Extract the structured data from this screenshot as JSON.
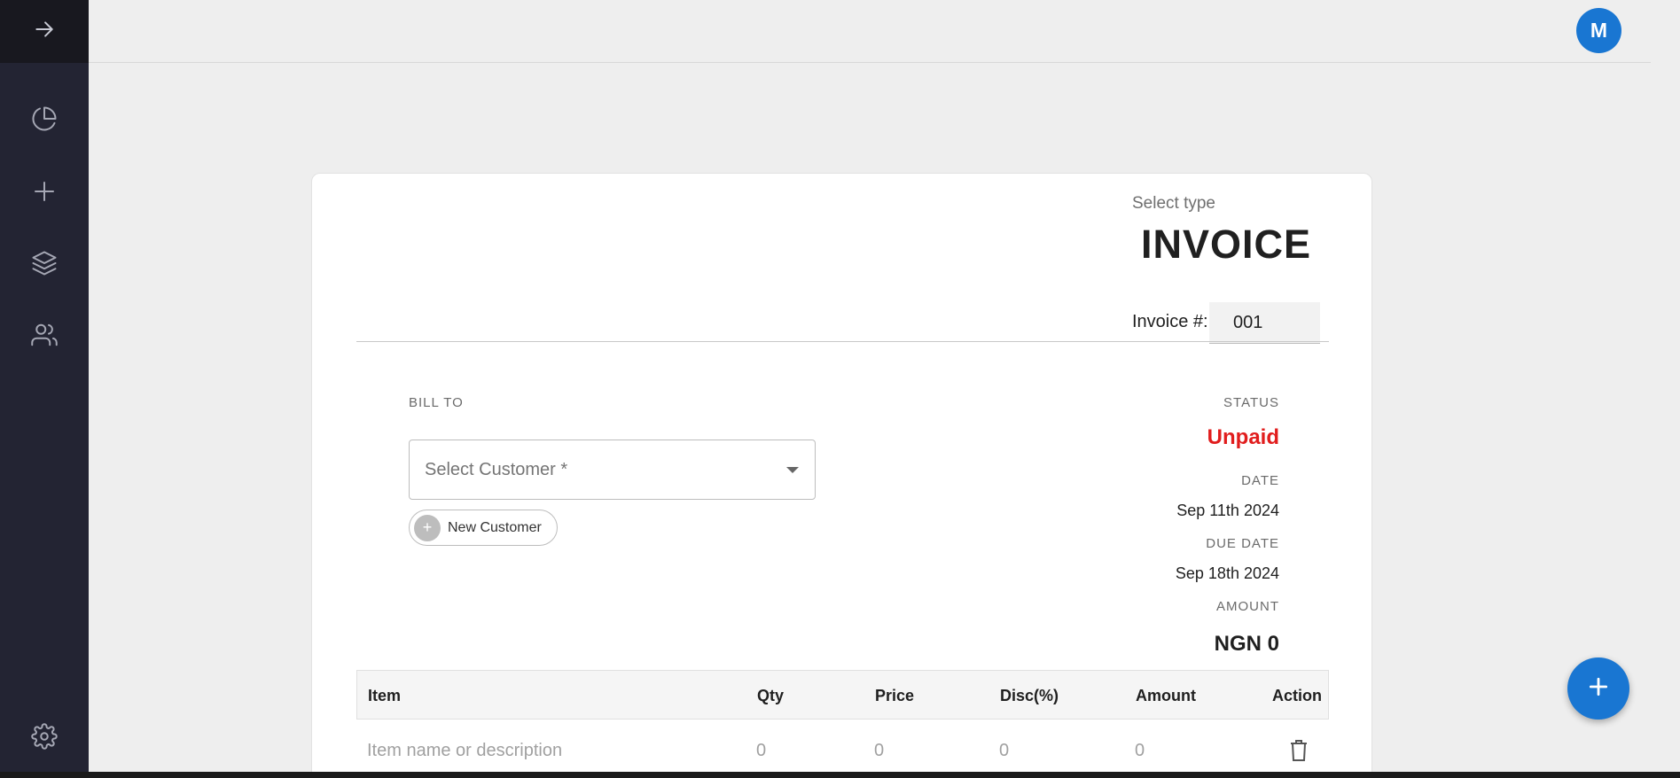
{
  "avatar": {
    "initial": "M",
    "color": "#1976d2"
  },
  "sidebar": {
    "items": [
      {
        "name": "arrow-right-icon"
      },
      {
        "name": "pie-chart-icon"
      },
      {
        "name": "plus-icon"
      },
      {
        "name": "layers-icon"
      },
      {
        "name": "users-icon"
      },
      {
        "name": "gear-icon"
      }
    ]
  },
  "doc": {
    "select_type_label": "Select type",
    "type": "INVOICE",
    "invoice_number_label": "Invoice #:",
    "invoice_number": "001"
  },
  "bill_to": {
    "label": "BILL TO",
    "customer_placeholder": "Select Customer *",
    "new_customer_label": "New Customer"
  },
  "meta": {
    "status_label": "STATUS",
    "status_value": "Unpaid",
    "status_color": "#e11d1d",
    "date_label": "DATE",
    "date_value": "Sep 11th 2024",
    "due_date_label": "DUE DATE",
    "due_date_value": "Sep 18th 2024",
    "amount_label": "AMOUNT",
    "amount_value": "NGN 0"
  },
  "table": {
    "headers": [
      "Item",
      "Qty",
      "Price",
      "Disc(%)",
      "Amount",
      "Action"
    ],
    "rows": [
      {
        "item_placeholder": "Item name or description",
        "qty": "0",
        "price": "0",
        "disc": "0",
        "amount": "0"
      }
    ]
  }
}
